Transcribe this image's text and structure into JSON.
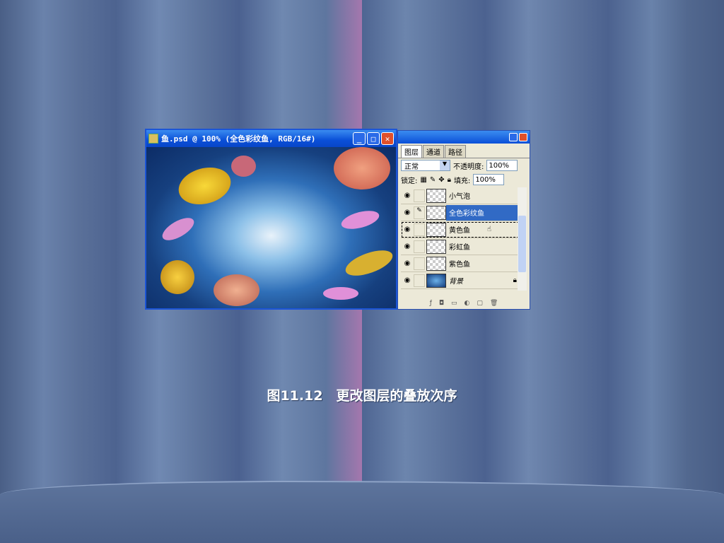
{
  "document_window": {
    "title": "鱼.psd @ 100% (全色彩纹鱼, RGB/16#)",
    "buttons": [
      "minimize",
      "maximize",
      "close"
    ]
  },
  "layers_panel": {
    "tabs": [
      "图层",
      "通道",
      "路径"
    ],
    "blend_mode": "正常",
    "opacity_label": "不透明度:",
    "opacity_value": "100%",
    "lock_label": "锁定:",
    "fill_label": "填充:",
    "fill_value": "100%",
    "layers": [
      {
        "name": "小气泡",
        "selected": false
      },
      {
        "name": "全色彩纹鱼",
        "selected": true
      },
      {
        "name": "黄色鱼",
        "selected": false
      },
      {
        "name": "彩虹鱼",
        "selected": false
      },
      {
        "name": "紫色鱼",
        "selected": false
      },
      {
        "name": "背景",
        "selected": false,
        "locked": true
      }
    ]
  },
  "caption": "图11.12　更改图层的叠放次序"
}
